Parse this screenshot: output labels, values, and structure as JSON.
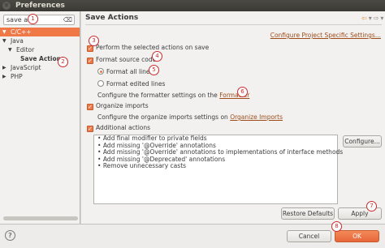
{
  "window": {
    "title": "Preferences"
  },
  "filter": {
    "value": "save act",
    "clear_icon": "clear-icon"
  },
  "tree": [
    {
      "label": "C/C++",
      "depth": 0,
      "expanded": true,
      "selected": true,
      "bold": false
    },
    {
      "label": "Java",
      "depth": 0,
      "expanded": true,
      "selected": false,
      "bold": false
    },
    {
      "label": "Editor",
      "depth": 1,
      "expanded": true,
      "selected": false,
      "bold": false
    },
    {
      "label": "Save Actions",
      "depth": 2,
      "expanded": null,
      "selected": false,
      "bold": true
    },
    {
      "label": "JavaScript",
      "depth": 0,
      "expanded": false,
      "selected": false,
      "bold": false
    },
    {
      "label": "PHP",
      "depth": 0,
      "expanded": false,
      "selected": false,
      "bold": false
    }
  ],
  "page": {
    "title": "Save Actions",
    "config_link": "Configure Project Specific Settings...",
    "perform_label": "Perform the selected actions on save",
    "format_label": "Format source code",
    "format_all": "Format all lines",
    "format_edited": "Format edited lines",
    "formatter_text": "The formatter settings on the",
    "formatter_prefix": "Configure the formatter settings on the",
    "formatter_link": "Formatter",
    "organize_label": "Organize imports",
    "organize_prefix": "Configure the organize imports settings on",
    "organize_link": "Organize Imports",
    "additional_label": "Additional actions",
    "actions": [
      "Add final modifier to private fields",
      "Add missing '@Override' annotations",
      "Add missing '@Override' annotations to implementations of interface methods",
      "Add missing '@Deprecated' annotations",
      "Remove unnecessary casts"
    ],
    "configure_button": "Configure...",
    "restore_button": "Restore Defaults",
    "apply_button": "Apply"
  },
  "footer": {
    "cancel_button": "Cancel",
    "ok_button": "OK",
    "help_icon": "?"
  },
  "badges": [
    "1",
    "2",
    "3",
    "4",
    "5",
    "6",
    "7",
    "8"
  ],
  "colors": {
    "accent": "#f07746",
    "badge": "#cc2a2a",
    "link": "#a04c1a"
  }
}
